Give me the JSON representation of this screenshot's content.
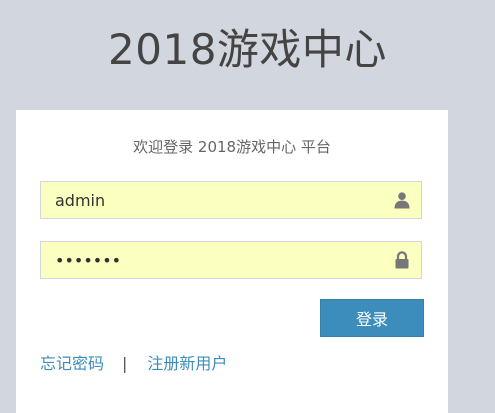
{
  "header": {
    "title": "2018游戏中心"
  },
  "login": {
    "message": "欢迎登录 2018游戏中心 平台",
    "username_value": "admin",
    "username_icon": "user-icon",
    "password_value": "1234567",
    "password_icon": "lock-icon",
    "submit_label": "登录",
    "forgot_link": "忘记密码",
    "separator": "|",
    "register_link": "注册新用户"
  },
  "colors": {
    "background": "#d2d6de",
    "field_fill": "#fbffc0",
    "primary": "#3c8dbc"
  }
}
